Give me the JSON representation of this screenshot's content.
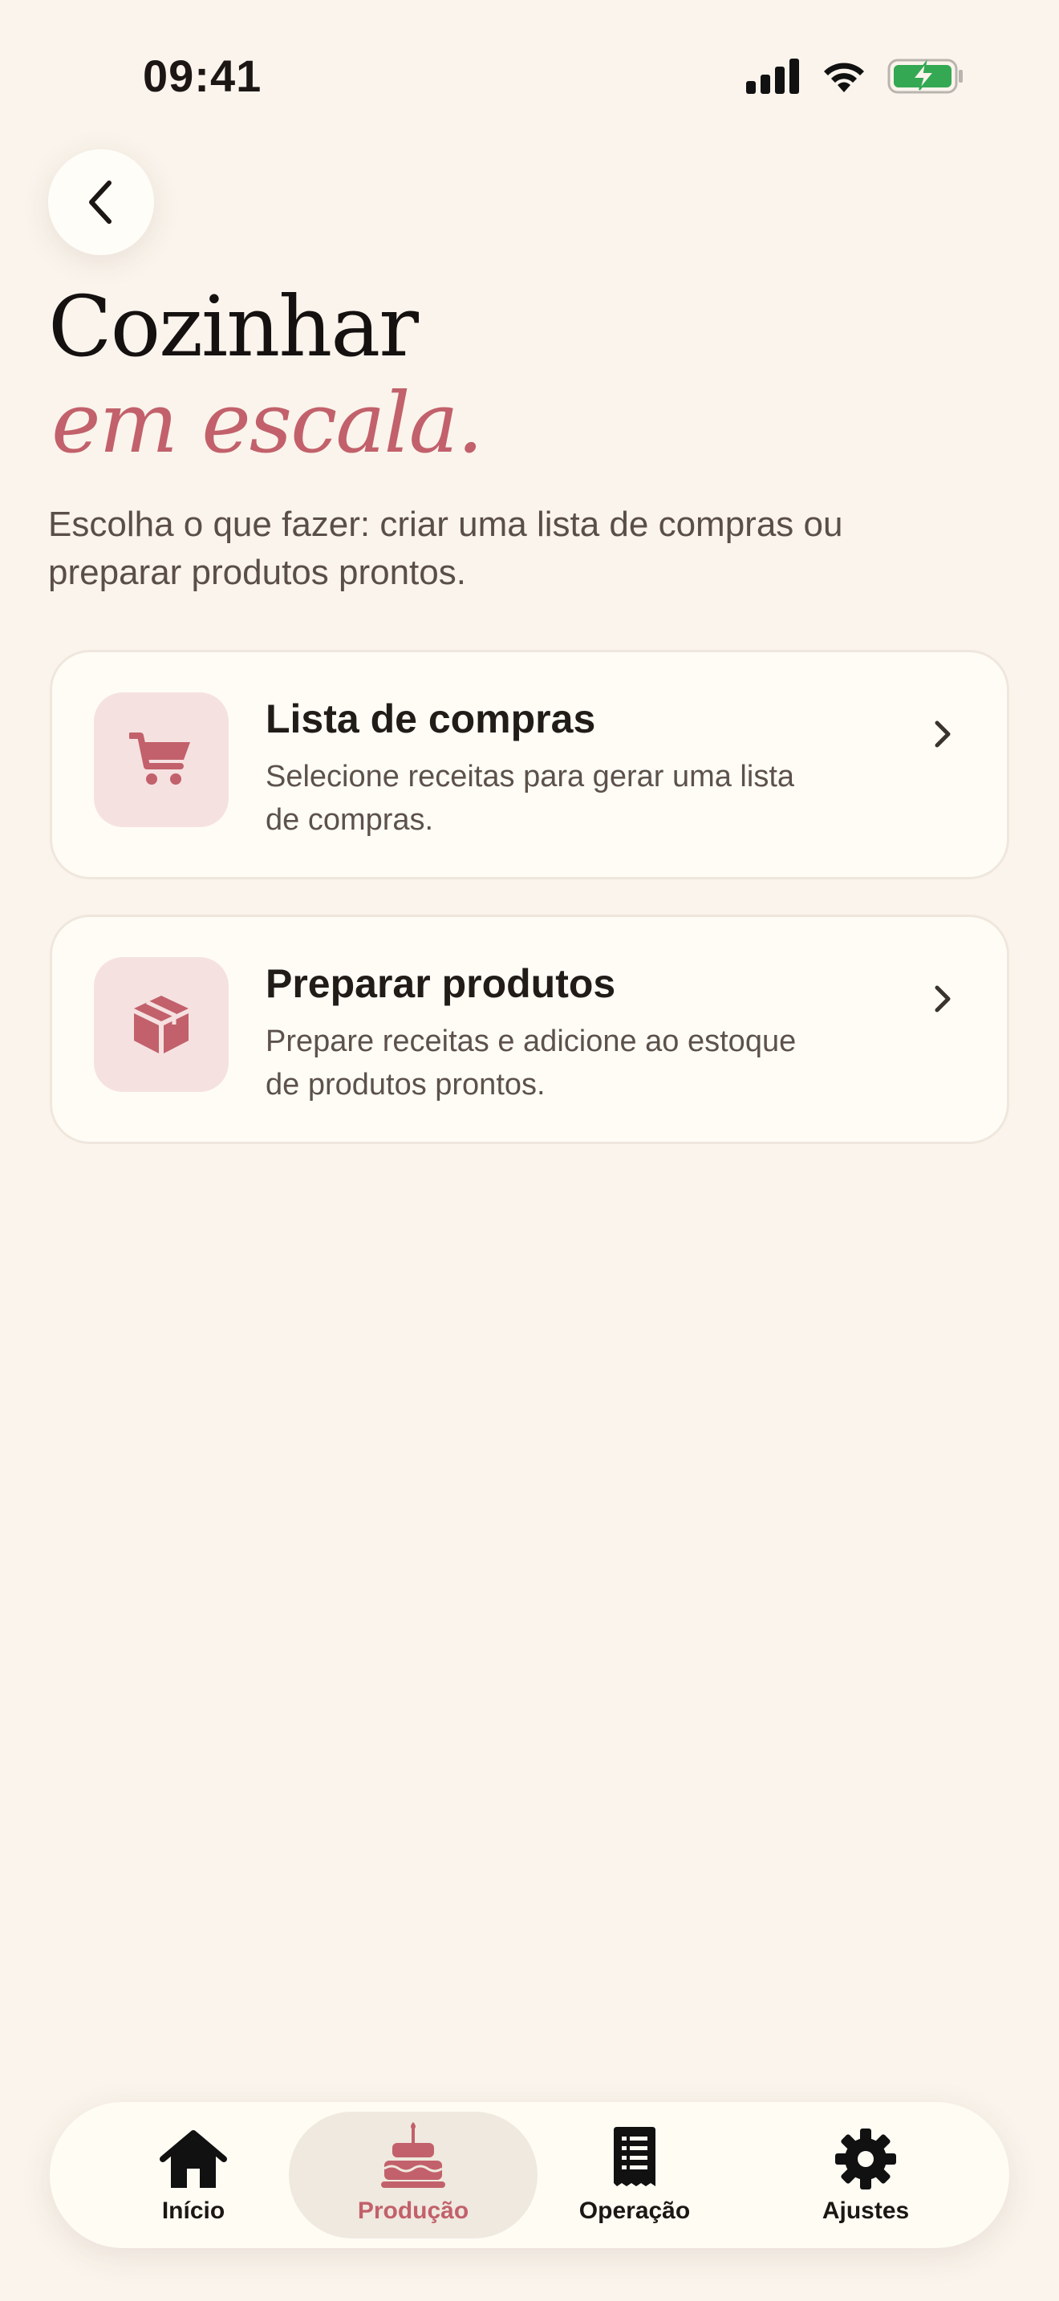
{
  "status_bar": {
    "time": "09:41",
    "battery_color": "#34a853"
  },
  "header": {
    "back_icon": "chevron-left-icon",
    "title": "Cozinhar",
    "subtitle": "em escala.",
    "description": "Escolha o que fazer: criar uma lista de compras ou preparar produtos prontos."
  },
  "options": [
    {
      "icon": "cart-icon",
      "title": "Lista de compras",
      "description": "Selecione receitas para gerar uma lista de compras."
    },
    {
      "icon": "box-icon",
      "title": "Preparar produtos",
      "description": "Prepare receitas e adicione ao estoque de produtos prontos."
    }
  ],
  "tab_bar": {
    "active_tab": "Produção",
    "tabs": [
      {
        "label": "Início",
        "icon": "home-icon"
      },
      {
        "label": "Produção",
        "icon": "cake-icon"
      },
      {
        "label": "Operação",
        "icon": "receipt-icon"
      },
      {
        "label": "Ajustes",
        "icon": "gear-icon"
      }
    ]
  },
  "colors": {
    "background": "#faf4ec",
    "accent": "#c2616b",
    "icon_tile": "#f6e1e1",
    "card": "#fffcf6"
  }
}
